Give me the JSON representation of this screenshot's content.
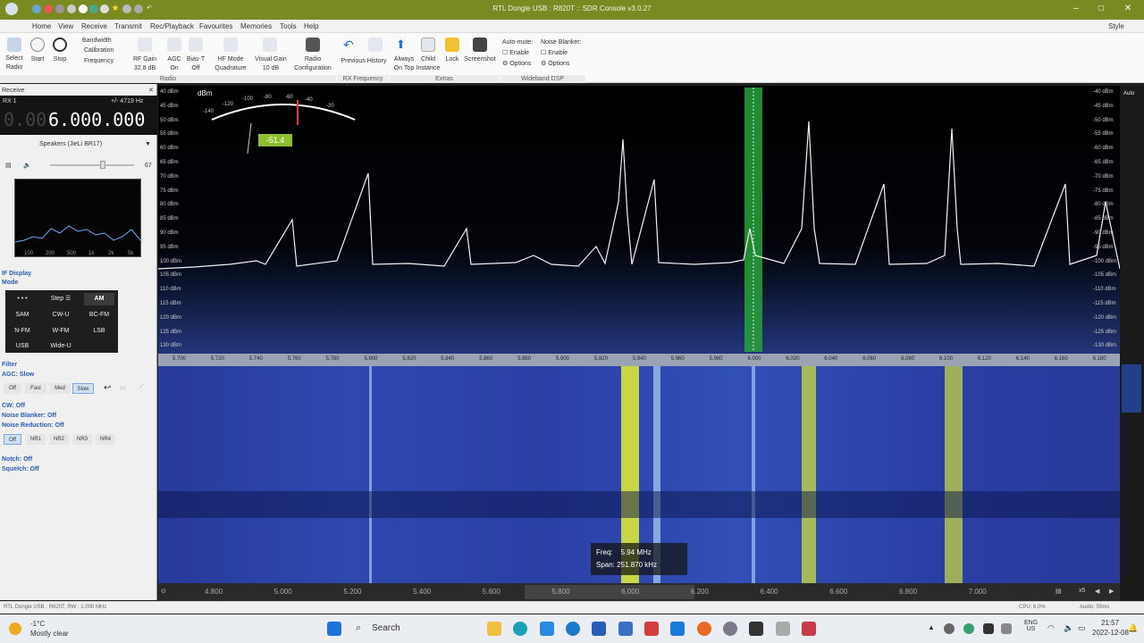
{
  "window": {
    "title": "RTL Dongle USB : R820T :: SDR Console v3.0.27"
  },
  "menu": [
    "Home",
    "View",
    "Receive",
    "Transmit",
    "Rec/Playback",
    "Favourites",
    "Memories",
    "Tools",
    "Help"
  ],
  "ribbon": {
    "select_radio": [
      "Select",
      "Radio"
    ],
    "start": "Start",
    "stop": "Stop",
    "bandwidth": "Bandwidth",
    "calibration": "Calibration",
    "frequency": "Frequency",
    "rf_gain": [
      "RF Gain",
      "32.8 dB"
    ],
    "agc": [
      "AGC",
      "On"
    ],
    "bias_t": [
      "Bias-T",
      "Off"
    ],
    "hf_mode": [
      "HF Mode",
      "Quadrature"
    ],
    "visual_gain": [
      "Visual Gain",
      "10 dB"
    ],
    "radio_config": [
      "Radio",
      "Configuration"
    ],
    "previous_history": "Previous History",
    "always_on_top": [
      "Always",
      "On Top"
    ],
    "child_instance": [
      "Child",
      "Instance"
    ],
    "lock": "Lock",
    "screenshot": "Screenshot",
    "auto_mute": "Auto-mute:",
    "noise_blanker": "Noise Blanker:",
    "enable": "Enable",
    "options": "Options",
    "groups": [
      "Radio",
      "RX Frequency",
      "Extras",
      "Wideband DSP"
    ],
    "style": "Style"
  },
  "left": {
    "receive": "Receive",
    "rx": "RX 1",
    "offset": "+/- 4719 Hz",
    "freq_dim": "0.00",
    "freq_main": "6.000.000",
    "speakers": "Speakers (JieLi BR17)",
    "volume": "67",
    "if_display": "IF Display",
    "mode": "Mode",
    "modes": [
      "• • •",
      "Step ☰",
      "AM",
      "SAM",
      "CW-U",
      "BC-FM",
      "N-FM",
      "W-FM",
      "LSB",
      "USB",
      "Wide-U"
    ],
    "filter": "Filter",
    "agc": "AGC: Slow",
    "agc_opts": [
      "Off",
      "Fast",
      "Med",
      "Slow"
    ],
    "cw": "CW: Off",
    "nb": "Noise Blanker: Off",
    "nr": "Noise Reduction: Off",
    "nr_opts": [
      "Off",
      "NR1",
      "NR2",
      "NR3",
      "NR4"
    ],
    "notch": "Notch: Off",
    "squelch": "Squelch: Off",
    "if_axis": [
      "100",
      "200",
      "500",
      "1k",
      "2k",
      "5k"
    ]
  },
  "meter": {
    "unit": "dBm",
    "reading": "-51.4",
    "scale": [
      "-140",
      "-120",
      "-100",
      "-80",
      "-60",
      "-40",
      "-20"
    ]
  },
  "spectrum": {
    "dbm_labels": [
      "40 dBm",
      "45 dBm",
      "50 dBm",
      "55 dBm",
      "60 dBm",
      "65 dBm",
      "70 dBm",
      "75 dBm",
      "80 dBm",
      "85 dBm",
      "90 dBm",
      "95 dBm",
      "100 dBm",
      "105 dBm",
      "110 dBm",
      "115 dBm",
      "120 dBm",
      "125 dBm",
      "130 dBm"
    ],
    "right_labels": [
      "-40 dBm",
      "-45 dBm",
      "-50 dBm",
      "-55 dBm",
      "-60 dBm",
      "-65 dBm",
      "-70 dBm",
      "-75 dBm",
      "-80 dBm",
      "-85 dBm",
      "-90 dBm",
      "-95 dBm",
      "-100 dBm",
      "-105 dBm",
      "-110 dBm",
      "-115 dBm",
      "-120 dBm",
      "-125 dBm",
      "-130 dBm"
    ],
    "auto": "Auto",
    "freq_ticks": [
      "5.700",
      "5.720",
      "5.740",
      "5.760",
      "5.780",
      "5.800",
      "5.820",
      "5.840",
      "5.860",
      "5.880",
      "5.900",
      "5.920",
      "5.940",
      "5.960",
      "5.980",
      "6.000",
      "6.020",
      "6.040",
      "6.060",
      "6.080",
      "6.100",
      "6.120",
      "6.140",
      "6.160",
      "6.180"
    ]
  },
  "tooltip": {
    "freq_label": "Freq:",
    "freq_value": "5.94  MHz",
    "span_label": "Span:",
    "span_value": "251.870  kHz"
  },
  "overview": {
    "ticks": [
      "4.800",
      "5.000",
      "5.200",
      "5.400",
      "5.600",
      "5.800",
      "6.000",
      "6.200",
      "6.400",
      "6.600",
      "6.800",
      "7.000"
    ],
    "zoom": "x5"
  },
  "status": {
    "left": "RTL Dongle USB : R820T, RW : 1.000 MHz",
    "cpu": "CPU: 6.0%",
    "audio": "Audio: 55ms"
  },
  "taskbar": {
    "temp": "-1°C",
    "weather": "Mostly clear",
    "search": "Search",
    "lang": "ENG",
    "region": "US",
    "time": "21:57",
    "date": "2022-12-08"
  }
}
